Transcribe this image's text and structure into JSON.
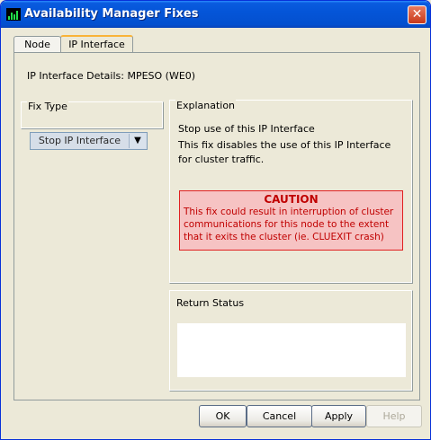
{
  "window": {
    "title": "Availability Manager Fixes",
    "close_glyph": "✕"
  },
  "tabs": [
    {
      "label": "Node",
      "active": false
    },
    {
      "label": "IP Interface",
      "active": true
    }
  ],
  "details": {
    "label": "IP Interface Details: MPESO  (WE0)"
  },
  "fix_type": {
    "title": "Fix Type",
    "selected": "Stop IP Interface",
    "arrow_glyph": "▼"
  },
  "explanation": {
    "title": "Explanation",
    "heading": "Stop use of this IP Interface",
    "line1": "This fix disables the use of this IP Interface",
    "line2": "for cluster traffic.",
    "caution_title": "CAUTION",
    "caution_line1": "This fix could result in interruption of cluster",
    "caution_line2": "communications for this node to the extent",
    "caution_line3": "that it exits the cluster (ie. CLUEXIT crash)"
  },
  "return_status": {
    "title": "Return Status",
    "value": ""
  },
  "buttons": {
    "ok": "OK",
    "cancel": "Cancel",
    "apply": "Apply",
    "help": "Help"
  },
  "colors": {
    "title_bar": "#0455D8",
    "caution_text": "#C00000",
    "caution_bg": "#F6C3C3"
  }
}
